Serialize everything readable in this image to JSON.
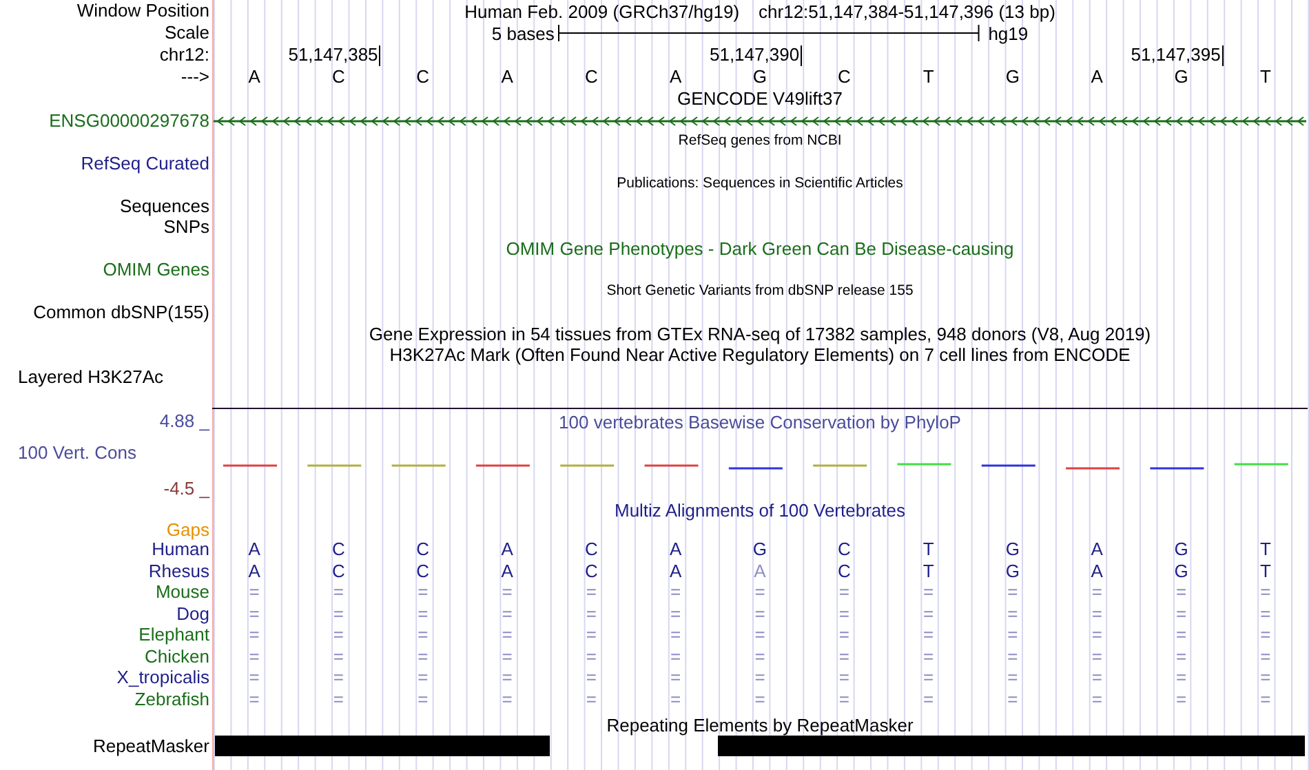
{
  "header": {
    "label": "Window Position",
    "assembly": "Human Feb. 2009 (GRCh37/hg19)",
    "position": "chr12:51,147,384-51,147,396 (13 bp)"
  },
  "scale": {
    "label": "Scale",
    "length": "5 bases",
    "assembly": "hg19"
  },
  "coordinates": {
    "label": "chr12:",
    "ticks": [
      "51,147,385",
      "51,147,390",
      "51,147,395"
    ]
  },
  "sequence": {
    "label": "--->",
    "bases": [
      "A",
      "C",
      "C",
      "A",
      "C",
      "A",
      "G",
      "C",
      "T",
      "G",
      "A",
      "G",
      "T"
    ]
  },
  "rows": [
    {
      "kind": "heading",
      "text": "GENCODE V49lift37",
      "color": "#000000"
    },
    {
      "kind": "gene",
      "label": "ENSG00000297678",
      "color": "#1a6e1a"
    },
    {
      "kind": "caption",
      "text": "RefSeq genes from NCBI"
    },
    {
      "kind": "label",
      "label": "RefSeq Curated",
      "color": "#1f1f8a"
    },
    {
      "kind": "caption",
      "text": "Publications: Sequences in Scientific Articles"
    },
    {
      "kind": "label",
      "label": "Sequences",
      "color": "#000000"
    },
    {
      "kind": "label",
      "label": "SNPs",
      "color": "#000000"
    },
    {
      "kind": "heading",
      "text": "OMIM Gene Phenotypes - Dark Green Can Be Disease-causing",
      "color": "#1a6e1a"
    },
    {
      "kind": "label",
      "label": "OMIM Genes",
      "color": "#1a6e1a"
    },
    {
      "kind": "caption",
      "text": "Short Genetic Variants from dbSNP release 155"
    },
    {
      "kind": "label",
      "label": "Common dbSNP(155)",
      "color": "#000000"
    },
    {
      "kind": "heading",
      "text": "Gene Expression in 54 tissues from GTEx RNA-seq of 17382 samples, 948 donors (V8, Aug 2019)",
      "color": "#000000"
    },
    {
      "kind": "heading",
      "text": "H3K27Ac Mark (Often Found Near Active Regulatory Elements) on 7 cell lines from ENCODE",
      "color": "#000000"
    },
    {
      "kind": "layered",
      "label": "Layered H3K27Ac",
      "color": "#000000"
    }
  ],
  "conservation": {
    "label": "100 Vert. Cons",
    "title": "100 vertebrates Basewise Conservation by PhyloP",
    "max_label": "4.88 _",
    "min_label": "-4.5 _"
  },
  "multiz": {
    "title": "Multiz Alignments of 100 Vertebrates",
    "gaps_label": "Gaps",
    "species": [
      {
        "name": "Human",
        "color": "#1f1f8a",
        "bases": [
          {
            "text": "A",
            "dimmed": false
          },
          {
            "text": "C",
            "dimmed": false
          },
          {
            "text": "C",
            "dimmed": false
          },
          {
            "text": "A",
            "dimmed": false
          },
          {
            "text": "C",
            "dimmed": false
          },
          {
            "text": "A",
            "dimmed": false
          },
          {
            "text": "G",
            "dimmed": false
          },
          {
            "text": "C",
            "dimmed": false
          },
          {
            "text": "T",
            "dimmed": false
          },
          {
            "text": "G",
            "dimmed": false
          },
          {
            "text": "A",
            "dimmed": false
          },
          {
            "text": "G",
            "dimmed": false
          },
          {
            "text": "T",
            "dimmed": false
          }
        ]
      },
      {
        "name": "Rhesus",
        "color": "#1f1f8a",
        "bases": [
          {
            "text": "A",
            "dimmed": false
          },
          {
            "text": "C",
            "dimmed": false
          },
          {
            "text": "C",
            "dimmed": false
          },
          {
            "text": "A",
            "dimmed": false
          },
          {
            "text": "C",
            "dimmed": false
          },
          {
            "text": "A",
            "dimmed": false
          },
          {
            "text": "A",
            "dimmed": true
          },
          {
            "text": "C",
            "dimmed": false
          },
          {
            "text": "T",
            "dimmed": false
          },
          {
            "text": "G",
            "dimmed": false
          },
          {
            "text": "A",
            "dimmed": false
          },
          {
            "text": "G",
            "dimmed": false
          },
          {
            "text": "T",
            "dimmed": false
          }
        ]
      },
      {
        "name": "Mouse",
        "color": "#1a6e1a",
        "bases": [
          {
            "text": "=",
            "dimmed": true
          },
          {
            "text": "=",
            "dimmed": true
          },
          {
            "text": "=",
            "dimmed": true
          },
          {
            "text": "=",
            "dimmed": true
          },
          {
            "text": "=",
            "dimmed": true
          },
          {
            "text": "=",
            "dimmed": true
          },
          {
            "text": "=",
            "dimmed": true
          },
          {
            "text": "=",
            "dimmed": true
          },
          {
            "text": "=",
            "dimmed": true
          },
          {
            "text": "=",
            "dimmed": true
          },
          {
            "text": "=",
            "dimmed": true
          },
          {
            "text": "=",
            "dimmed": true
          },
          {
            "text": "=",
            "dimmed": true
          }
        ]
      },
      {
        "name": "Dog",
        "color": "#1f1f8a",
        "bases": [
          {
            "text": "=",
            "dimmed": true
          },
          {
            "text": "=",
            "dimmed": true
          },
          {
            "text": "=",
            "dimmed": true
          },
          {
            "text": "=",
            "dimmed": true
          },
          {
            "text": "=",
            "dimmed": true
          },
          {
            "text": "=",
            "dimmed": true
          },
          {
            "text": "=",
            "dimmed": true
          },
          {
            "text": "=",
            "dimmed": true
          },
          {
            "text": "=",
            "dimmed": true
          },
          {
            "text": "=",
            "dimmed": true
          },
          {
            "text": "=",
            "dimmed": true
          },
          {
            "text": "=",
            "dimmed": true
          },
          {
            "text": "=",
            "dimmed": true
          }
        ]
      },
      {
        "name": "Elephant",
        "color": "#1a6e1a",
        "bases": [
          {
            "text": "=",
            "dimmed": true
          },
          {
            "text": "=",
            "dimmed": true
          },
          {
            "text": "=",
            "dimmed": true
          },
          {
            "text": "=",
            "dimmed": true
          },
          {
            "text": "=",
            "dimmed": true
          },
          {
            "text": "=",
            "dimmed": true
          },
          {
            "text": "=",
            "dimmed": true
          },
          {
            "text": "=",
            "dimmed": true
          },
          {
            "text": "=",
            "dimmed": true
          },
          {
            "text": "=",
            "dimmed": true
          },
          {
            "text": "=",
            "dimmed": true
          },
          {
            "text": "=",
            "dimmed": true
          },
          {
            "text": "=",
            "dimmed": true
          }
        ]
      },
      {
        "name": "Chicken",
        "color": "#1a6e1a",
        "bases": [
          {
            "text": "=",
            "dimmed": true
          },
          {
            "text": "=",
            "dimmed": true
          },
          {
            "text": "=",
            "dimmed": true
          },
          {
            "text": "=",
            "dimmed": true
          },
          {
            "text": "=",
            "dimmed": true
          },
          {
            "text": "=",
            "dimmed": true
          },
          {
            "text": "=",
            "dimmed": true
          },
          {
            "text": "=",
            "dimmed": true
          },
          {
            "text": "=",
            "dimmed": true
          },
          {
            "text": "=",
            "dimmed": true
          },
          {
            "text": "=",
            "dimmed": true
          },
          {
            "text": "=",
            "dimmed": true
          },
          {
            "text": "=",
            "dimmed": true
          }
        ]
      },
      {
        "name": "X_tropicalis",
        "color": "#1f1f8a",
        "bases": [
          {
            "text": "=",
            "dimmed": true
          },
          {
            "text": "=",
            "dimmed": true
          },
          {
            "text": "=",
            "dimmed": true
          },
          {
            "text": "=",
            "dimmed": true
          },
          {
            "text": "=",
            "dimmed": true
          },
          {
            "text": "=",
            "dimmed": true
          },
          {
            "text": "=",
            "dimmed": true
          },
          {
            "text": "=",
            "dimmed": true
          },
          {
            "text": "=",
            "dimmed": true
          },
          {
            "text": "=",
            "dimmed": true
          },
          {
            "text": "=",
            "dimmed": true
          },
          {
            "text": "=",
            "dimmed": true
          },
          {
            "text": "=",
            "dimmed": true
          }
        ]
      },
      {
        "name": "Zebrafish",
        "color": "#1a6e1a",
        "bases": [
          {
            "text": "=",
            "dimmed": true
          },
          {
            "text": "=",
            "dimmed": true
          },
          {
            "text": "=",
            "dimmed": true
          },
          {
            "text": "=",
            "dimmed": true
          },
          {
            "text": "=",
            "dimmed": true
          },
          {
            "text": "=",
            "dimmed": true
          },
          {
            "text": "=",
            "dimmed": true
          },
          {
            "text": "=",
            "dimmed": true
          },
          {
            "text": "=",
            "dimmed": true
          },
          {
            "text": "=",
            "dimmed": true
          },
          {
            "text": "=",
            "dimmed": true
          },
          {
            "text": "=",
            "dimmed": true
          },
          {
            "text": "=",
            "dimmed": true
          }
        ]
      }
    ]
  },
  "repeats": {
    "title": "Repeating Elements by RepeatMasker",
    "label": "RepeatMasker"
  }
}
